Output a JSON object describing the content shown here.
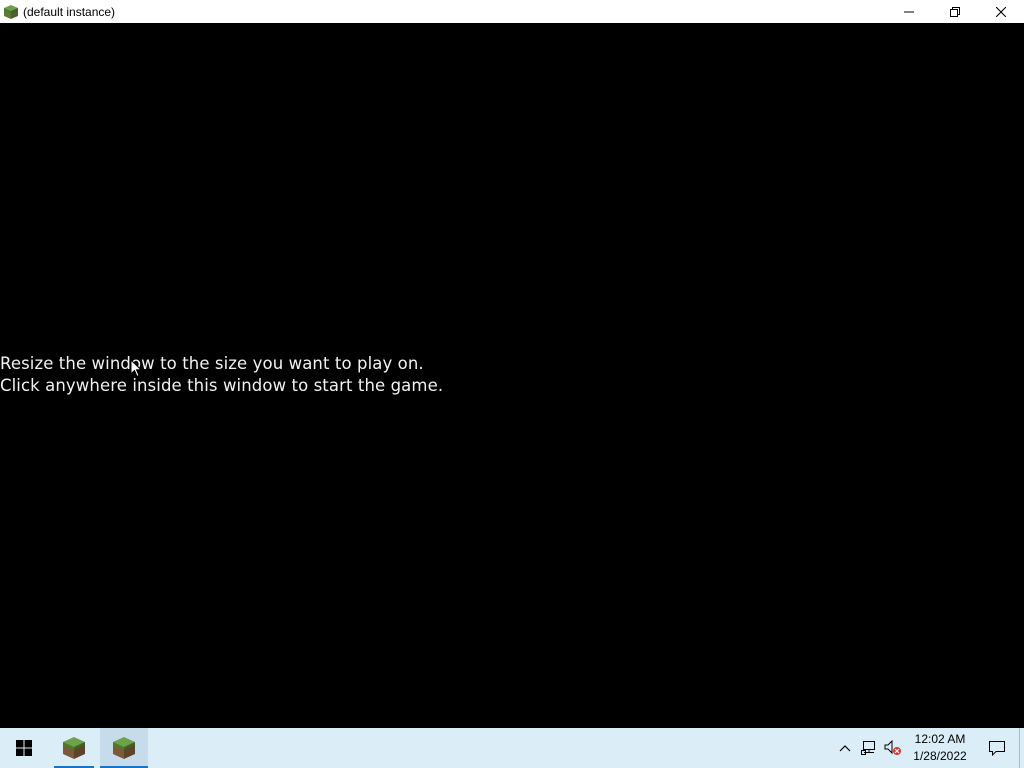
{
  "window": {
    "title": "(default instance)",
    "icon": "grass-block-icon",
    "controls": [
      "minimize-icon",
      "restore-icon",
      "close-icon"
    ]
  },
  "game": {
    "line1": "Resize the window to the size you want to play on.",
    "line2": "Click anywhere inside this window to start the game."
  },
  "taskbar": {
    "start_icon": "windows-logo-icon",
    "items": [
      {
        "icon": "grass-block-icon",
        "active": false
      },
      {
        "icon": "grass-block-icon",
        "active": true
      }
    ],
    "tray_icons": [
      "chevron-up-icon",
      "network-icon",
      "volume-muted-icon"
    ],
    "time": "12:02 AM",
    "date": "1/28/2022",
    "notification_icon": "notification-icon"
  },
  "colors": {
    "taskbar_bg": "#dbeef7",
    "accent": "#1a73c9",
    "game_bg": "#000000"
  }
}
